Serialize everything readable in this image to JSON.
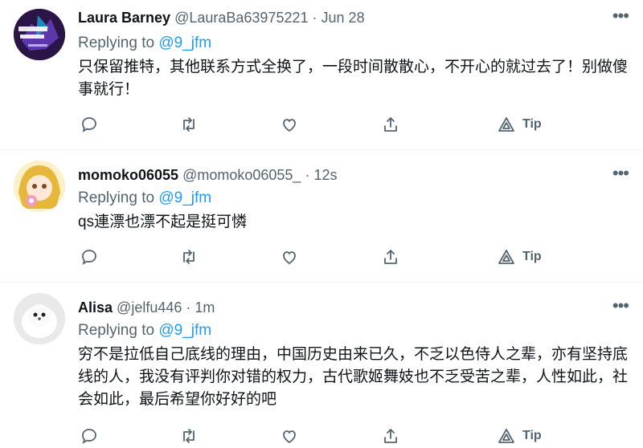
{
  "tweets": [
    {
      "name": "Laura Barney",
      "handle": "@LauraBa63975221",
      "time": "Jun 28",
      "replying_prefix": "Replying to",
      "replying_to": "@9_jfm",
      "text": "只保留推特，其他联系方式全换了，一段时间散散心，不开心的就过去了！别做傻事就行！",
      "tip_label": "Tip"
    },
    {
      "name": "momoko06055",
      "handle": "@momoko06055_",
      "time": "12s",
      "replying_prefix": "Replying to",
      "replying_to": "@9_jfm",
      "text": "qs連漂也漂不起是挺可憐",
      "tip_label": "Tip"
    },
    {
      "name": "Alisa",
      "handle": "@jelfu446",
      "time": "1m",
      "replying_prefix": "Replying to",
      "replying_to": "@9_jfm",
      "text": "穷不是拉低自己底线的理由，中国历史由来已久，不乏以色侍人之辈，亦有坚持底线的人，我没有评判你对错的权力，古代歌姬舞妓也不乏受苦之辈，人性如此，社会如此，最后希望你好好的吧",
      "tip_label": "Tip"
    }
  ],
  "separator": "·",
  "icons": [
    "reply-icon",
    "retweet-icon",
    "like-icon",
    "share-icon",
    "tip-icon",
    "more-icon"
  ],
  "colors": {
    "link": "#1d9bf0",
    "secondary": "#536471",
    "text": "#0f1419",
    "divider": "#eff3f4"
  }
}
